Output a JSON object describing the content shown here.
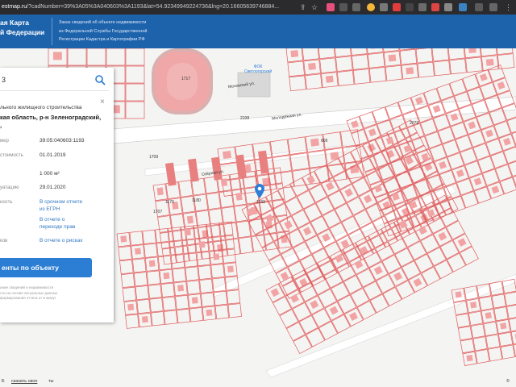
{
  "browser": {
    "url_domain": "estmap.ru",
    "url_rest": "/?cadNumber=39%3A05%3A040603%3A1193&lat=54.92349949224736&lng=20.16605639746884..."
  },
  "header": {
    "title_lines": [
      "ая Карта",
      "й Федерации"
    ],
    "subtitle_lines": [
      "Заказ сведений об объекте недвижимости",
      "из Федеральной Службы Государственной",
      "Регистрации Кадастра и Картографии РФ"
    ]
  },
  "panel": {
    "search_value": "3",
    "close_symbol": "×",
    "type_text": "льного жилищного строительства",
    "address_lines": [
      "кая область, р-н Зеленоградский,",
      ","
    ],
    "rows": [
      {
        "label": "мер",
        "value": "39:05:040603:1193"
      },
      {
        "label": "стоимость",
        "value": "01.01.2019"
      },
      {
        "label": "",
        "value": "1 000 м²"
      },
      {
        "label": "уатацию",
        "value": "29.01.2020"
      },
      {
        "label": "ность",
        "value": "В срочном отчете из ЕГРН"
      },
      {
        "label": "",
        "value": "В отчете о переходе прав"
      },
      {
        "label": "ков",
        "value": "В отчете о рисках"
      }
    ],
    "docs_button": "енты по объекту",
    "disclaimer_lines": [
      "ание сведений и недвижимости",
      "сти на основе актуальных данных",
      "формирования отчета от 5 минут"
    ]
  },
  "map": {
    "labels": [
      {
        "text": "Мочовский ул.",
        "name": "street-label-1"
      },
      {
        "text": "Молодёжная ул.",
        "name": "street-label-2"
      },
      {
        "text": "ФОК Светлогорский",
        "name": "poi-label"
      },
      {
        "text": "Озёрная ул.",
        "name": "street-label-3"
      },
      {
        "text": "1193",
        "name": "parcel-label-selected"
      },
      {
        "text": "1709",
        "name": "parcel-label-a"
      },
      {
        "text": "1717",
        "name": "parcel-label-b"
      },
      {
        "text": "1707",
        "name": "parcel-label-c"
      },
      {
        "text": "2108",
        "name": "parcel-label-d"
      },
      {
        "text": "2079",
        "name": "parcel-label-e"
      },
      {
        "text": "609",
        "name": "parcel-label-f"
      },
      {
        "text": "1179",
        "name": "parcel-label-g"
      },
      {
        "text": "1180",
        "name": "parcel-label-h"
      }
    ],
    "accent_red": "#e05a5a",
    "marker_color": "#2d7ed6"
  },
  "footer": {
    "left_links": [
      "Б",
      "сказать свое",
      "ты"
    ],
    "right_text": "©"
  }
}
